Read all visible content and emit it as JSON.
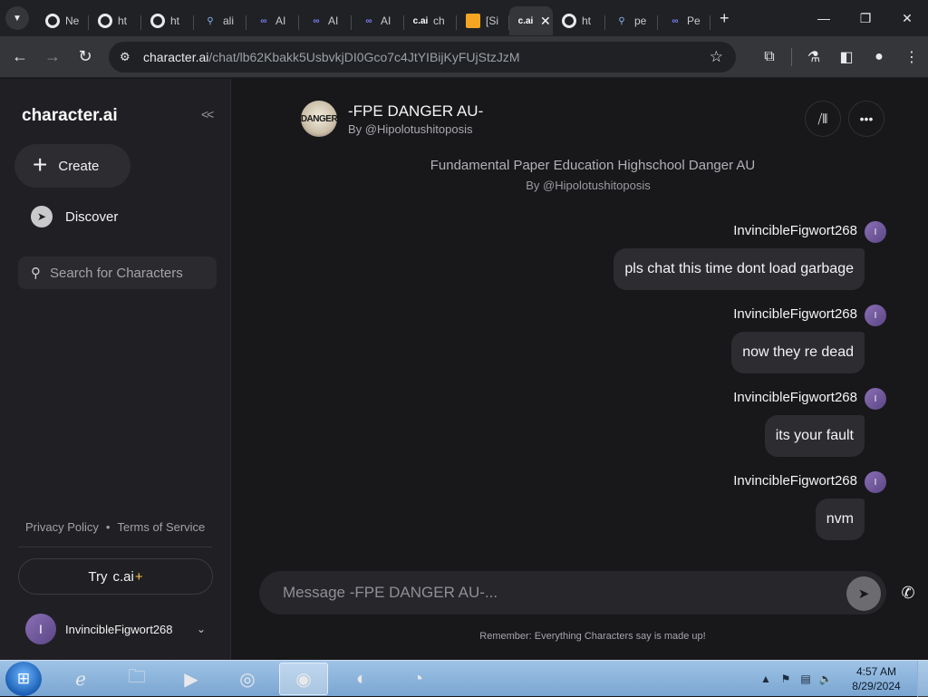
{
  "browser": {
    "tabs": [
      {
        "icon": "google-icon",
        "label": "Ne"
      },
      {
        "icon": "google-icon",
        "label": "ht"
      },
      {
        "icon": "google-icon",
        "label": "ht"
      },
      {
        "icon": "search-icon",
        "label": "ali"
      },
      {
        "icon": "meta-icon",
        "label": "AI"
      },
      {
        "icon": "meta-icon",
        "label": "AI"
      },
      {
        "icon": "meta-icon",
        "label": "AI"
      },
      {
        "icon": "cai-icon",
        "favicon_text": "c.ai",
        "label": "ch"
      },
      {
        "icon": "mail-icon",
        "label": "[Si"
      },
      {
        "icon": "cai-icon",
        "favicon_text": "c.ai",
        "label": "",
        "active": true
      },
      {
        "icon": "google-icon",
        "label": "ht"
      },
      {
        "icon": "search-icon",
        "label": "pe"
      },
      {
        "icon": "meta-icon",
        "label": "Pe"
      }
    ],
    "url_host": "character.ai",
    "url_path": "/chat/lb62Kbakk5UsbvkjDI0Gco7c4JtYIBijKyFUjStzJzM"
  },
  "sidebar": {
    "brand": "character.ai",
    "create_label": "Create",
    "discover_label": "Discover",
    "search_placeholder": "Search for Characters",
    "privacy_label": "Privacy Policy",
    "bullet": "•",
    "terms_label": "Terms of Service",
    "try_label": "Try",
    "try_brand": "c.ai",
    "try_plus": "+",
    "user_initial": "I",
    "username": "InvincibleFigwort268"
  },
  "chat": {
    "character_avatar_text": "DANGER",
    "character_name": "-FPE DANGER AU-",
    "character_by": "By @Hipolotushitoposis",
    "intro_title": "Fundamental Paper Education Highschool Danger AU",
    "intro_by": "By @Hipolotushitoposis",
    "messages": [
      {
        "author": "InvincibleFigwort268",
        "avatar": "I",
        "text": "pls chat this time dont load garbage"
      },
      {
        "author": "InvincibleFigwort268",
        "avatar": "I",
        "text": "now they re dead"
      },
      {
        "author": "InvincibleFigwort268",
        "avatar": "I",
        "text": "its your fault"
      },
      {
        "author": "InvincibleFigwort268",
        "avatar": "I",
        "text": "nvm"
      }
    ],
    "composer_placeholder": "Message -FPE DANGER AU-...",
    "disclaimer": "Remember: Everything Characters say is made up!"
  },
  "taskbar": {
    "time": "4:57 AM",
    "date": "8/29/2024"
  },
  "colors": {
    "app_bg": "#18181b",
    "sidebar_bg": "#202024",
    "bubble_bg": "#2c2c31",
    "accent_plus": "#f5c84c"
  }
}
